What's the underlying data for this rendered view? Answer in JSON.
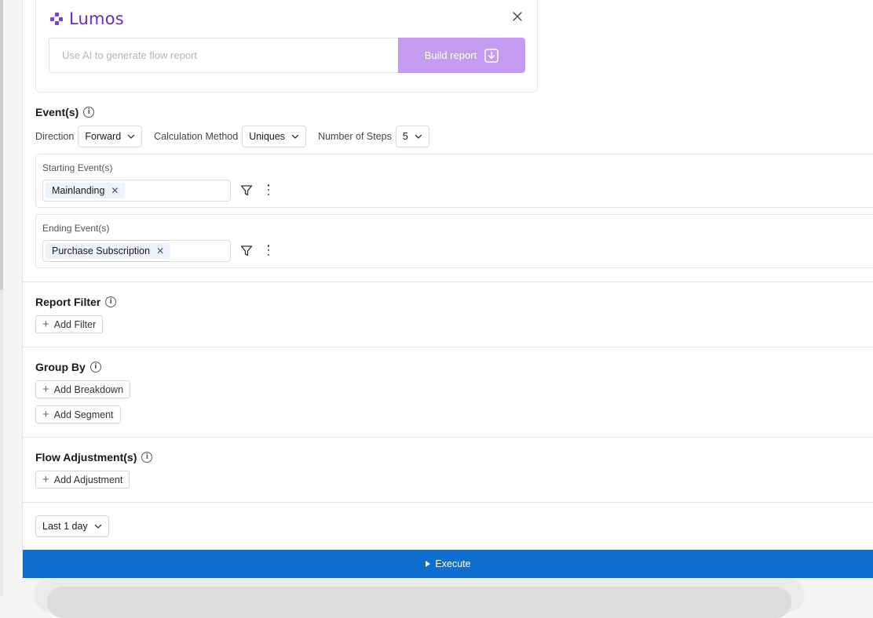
{
  "lumos": {
    "title": "Lumos",
    "input_placeholder": "Use AI to generate flow report",
    "build_label": "Build report"
  },
  "events": {
    "title": "Event(s)",
    "direction_label": "Direction",
    "direction_value": "Forward",
    "calc_label": "Calculation Method",
    "calc_value": "Uniques",
    "steps_label": "Number of Steps",
    "steps_value": "5",
    "starting_label": "Starting Event(s)",
    "starting_chip": "Mainlanding",
    "ending_label": "Ending Event(s)",
    "ending_chip": "Purchase Subscription"
  },
  "report_filter": {
    "title": "Report Filter",
    "add_label": "Add Filter"
  },
  "group_by": {
    "title": "Group By",
    "breakdown_label": "Add Breakdown",
    "segment_label": "Add Segment"
  },
  "flow_adjustment": {
    "title": "Flow Adjustment(s)",
    "add_label": "Add Adjustment"
  },
  "date_range": {
    "value": "Last 1 day"
  },
  "execute": {
    "label": "Execute"
  },
  "colors": {
    "accent": "#0f6fd1",
    "lumos": "#6a2fc2",
    "build_button": "#c59bf2"
  }
}
